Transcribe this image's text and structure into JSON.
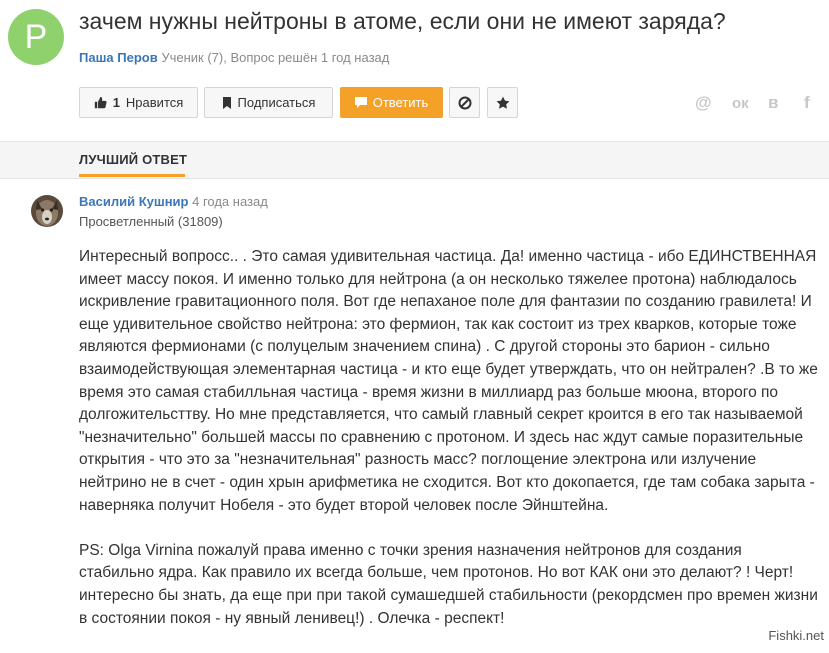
{
  "question": {
    "avatar_letter": "P",
    "title": "зачем нужны нейтроны в атоме, если они не имеют заряда?",
    "author": "Паша Перов",
    "meta": "Ученик (7), Вопрос решён 1 год назад"
  },
  "actions": {
    "like_count": "1",
    "like_label": "Нравится",
    "subscribe_label": "Подписаться",
    "answer_label": "Ответить"
  },
  "social": {
    "mail": "@",
    "ok": "ок",
    "vk": "в",
    "fb": "f"
  },
  "tab": {
    "label": "ЛУЧШИЙ ОТВЕТ"
  },
  "answer": {
    "author": "Василий Кушнир",
    "time": "4 года назад",
    "rank": "Просветленный (31809)",
    "paragraph1": "Интересный вопросс.. . Это самая удивительная частица. Да! именно частица - ибо ЕДИНСТВЕННАЯ имеет массу покоя. И именно только для нейтрона (а он несколько тяжелее протона) наблюдалось искривление гравитационного поля. Вот где непаханое поле для фантазии по созданию гравилета! И еще удивительное свойство нейтрона: это фермион, так как состоит из трех кварков, которые тоже являются фермионами (с полуцелым значением спина) . С другой стороны это барион - сильно взаимодействующая элементарная частица - и кто еще будет утверждать, что он нейтрален? .В то же время это самая стабилльная частица - время жизни в миллиард раз больше мюона, второго по долгожительсттву. Но мне представляется, что самый главный секрет кроится в его так называемой \"незначительно\" большей массы по сравнению с протоном. И здесь нас ждут самые поразительные открытия - что это за \"незначительная\" разность масс? поглощение электрона или излучение нейтрино не в счет - один хрын арифметика не сходится. Вот кто докопается, где там собака зарыта - наверняка получит Нобеля - это будет второй человек после Эйнштейна.",
    "paragraph2": "PS: Olga Virnina пожалуй права именно с точки зрения назначения нейтронов для создания стабильно ядра. Как правило их всегда больше, чем протонов. Но вот КАК они это делают? ! Черт! интересно бы знать, да еще при при такой сумашедшей стабильности (рекордсмен про времен жизни в состоянии покоя - ну явный ленивец!) . Олечка - респект!"
  },
  "watermark": "Fishki.net",
  "colors": {
    "accent_orange": "#f4a227",
    "avatar_green": "#8fd16c",
    "link_blue": "#3a76b8"
  }
}
